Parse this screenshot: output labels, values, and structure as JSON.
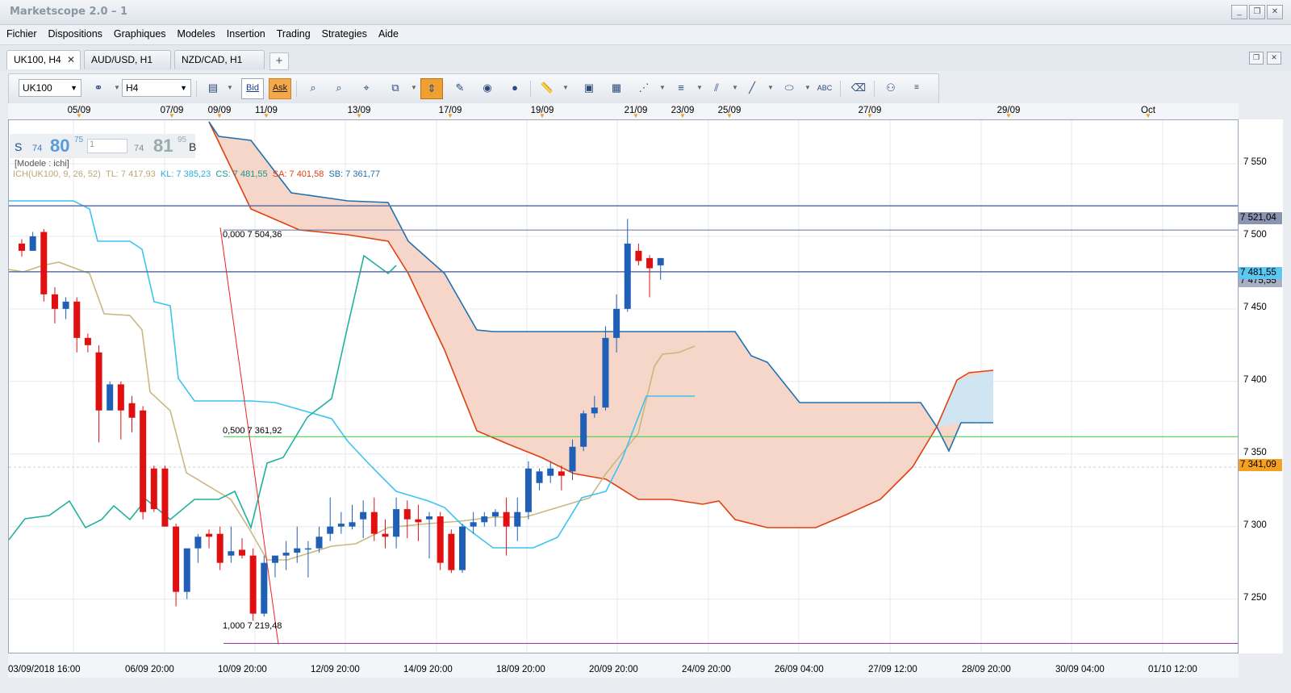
{
  "window": {
    "title": "Marketscope 2.0 – 1"
  },
  "menu": [
    "Fichier",
    "Dispositions",
    "Graphiques",
    "Modeles",
    "Insertion",
    "Trading",
    "Strategies",
    "Aide"
  ],
  "tabs": [
    {
      "label": "UK100, H4",
      "active": true
    },
    {
      "label": "AUD/USD, H1",
      "active": false
    },
    {
      "label": "NZD/CAD, H1",
      "active": false
    }
  ],
  "toolbar": {
    "instrument": "UK100",
    "timeframe": "H4",
    "bid_label": "Bid",
    "ask_label": "Ask"
  },
  "quote": {
    "sell_label": "S",
    "sell_small": "74",
    "sell_big": "80",
    "sell_sup": "75",
    "amount": "1",
    "buy_small": "74",
    "buy_big": "81",
    "buy_sup": "95",
    "buy_label": "B"
  },
  "indicator": {
    "model_label": "[Modele : ichi]",
    "ich": "ICH(UK100, 9, 26, 52)",
    "tl": "TL: 7 417,93",
    "kl": "KL: 7 385,23",
    "cs": "CS: 7 481,55",
    "sa": "SA: 7 401,58",
    "sb": "SB: 7 361,77"
  },
  "fib": {
    "level0": "0,000 7 504,36",
    "level50": "0,500 7 361,92",
    "level100": "1,000 7 219,48"
  },
  "price_boxes": {
    "upper": "7 521,04",
    "current": "7 481,55",
    "behind": "7 475,55",
    "orange": "7 341,09"
  },
  "colors": {
    "up": "#1f5fb5",
    "down": "#e01010",
    "cloud": "#f5d6c8",
    "tenkan": "#c8b880",
    "kijun": "#3cc4f0",
    "chikou": "#20b0a0",
    "spanA": "#e04010",
    "spanB": "#2070b0"
  },
  "chart_data": {
    "type": "candlestick",
    "instrument": "UK100",
    "timeframe": "H4",
    "y_ticks": [
      "7 550",
      "7 500",
      "7 450",
      "7 400",
      "7 350",
      "7 300",
      "7 250"
    ],
    "ylim": [
      7212,
      7580
    ],
    "top_dates": [
      "05/09",
      "07/09",
      "09/09",
      "11/09",
      "13/09",
      "17/09",
      "19/09",
      "21/09",
      "23/09",
      "25/09",
      "27/09",
      "29/09",
      "Oct"
    ],
    "bottom_dates": [
      "03/09/2018 16:00",
      "06/09 20:00",
      "10/09 20:00",
      "12/09 20:00",
      "14/09 20:00",
      "18/09 20:00",
      "20/09 20:00",
      "24/09 20:00",
      "26/09 04:00",
      "27/09 12:00",
      "28/09 20:00",
      "30/09 04:00",
      "01/10 12:00"
    ],
    "candles": [
      [
        7495,
        7498,
        7486,
        7490
      ],
      [
        7490,
        7503,
        7495,
        7500
      ],
      [
        7503,
        7505,
        7455,
        7460
      ],
      [
        7460,
        7465,
        7440,
        7450
      ],
      [
        7450,
        7458,
        7443,
        7455
      ],
      [
        7455,
        7458,
        7420,
        7430
      ],
      [
        7430,
        7433,
        7420,
        7425
      ],
      [
        7420,
        7425,
        7358,
        7380
      ],
      [
        7380,
        7400,
        7383,
        7398
      ],
      [
        7398,
        7400,
        7360,
        7380
      ],
      [
        7385,
        7390,
        7365,
        7375
      ],
      [
        7380,
        7383,
        7305,
        7310
      ],
      [
        7340,
        7342,
        7310,
        7312
      ],
      [
        7340,
        7342,
        7300,
        7300
      ],
      [
        7300,
        7302,
        7245,
        7255
      ],
      [
        7255,
        7275,
        7250,
        7285
      ],
      [
        7285,
        7295,
        7275,
        7293
      ],
      [
        7295,
        7298,
        7285,
        7293
      ],
      [
        7295,
        7300,
        7270,
        7275
      ],
      [
        7280,
        7300,
        7275,
        7283
      ],
      [
        7284,
        7292,
        7278,
        7280
      ],
      [
        7280,
        7285,
        7235,
        7240
      ],
      [
        7240,
        7280,
        7238,
        7275
      ],
      [
        7275,
        7280,
        7265,
        7280
      ],
      [
        7280,
        7290,
        7270,
        7282
      ],
      [
        7282,
        7300,
        7275,
        7285
      ],
      [
        7285,
        7290,
        7265,
        7285
      ],
      [
        7285,
        7300,
        7282,
        7293
      ],
      [
        7295,
        7320,
        7290,
        7300
      ],
      [
        7300,
        7310,
        7295,
        7302
      ],
      [
        7300,
        7315,
        7298,
        7303
      ],
      [
        7305,
        7318,
        7292,
        7310
      ],
      [
        7310,
        7320,
        7290,
        7295
      ],
      [
        7295,
        7305,
        7285,
        7293
      ],
      [
        7293,
        7320,
        7285,
        7312
      ],
      [
        7312,
        7318,
        7292,
        7305
      ],
      [
        7305,
        7315,
        7290,
        7303
      ],
      [
        7305,
        7310,
        7278,
        7307
      ],
      [
        7307,
        7310,
        7270,
        7275
      ],
      [
        7295,
        7298,
        7268,
        7270
      ],
      [
        7270,
        7302,
        7268,
        7300
      ],
      [
        7300,
        7310,
        7295,
        7303
      ],
      [
        7303,
        7310,
        7300,
        7307
      ],
      [
        7307,
        7312,
        7300,
        7310
      ],
      [
        7310,
        7320,
        7280,
        7300
      ],
      [
        7300,
        7320,
        7290,
        7310
      ],
      [
        7310,
        7345,
        7305,
        7340
      ],
      [
        7330,
        7340,
        7325,
        7338
      ],
      [
        7335,
        7345,
        7330,
        7340
      ],
      [
        7338,
        7342,
        7325,
        7335
      ],
      [
        7338,
        7360,
        7332,
        7355
      ],
      [
        7355,
        7380,
        7352,
        7378
      ],
      [
        7378,
        7390,
        7375,
        7382
      ],
      [
        7382,
        7438,
        7380,
        7430
      ],
      [
        7430,
        7460,
        7420,
        7450
      ],
      [
        7450,
        7512,
        7448,
        7495
      ],
      [
        7490,
        7495,
        7480,
        7483
      ],
      [
        7485,
        7487,
        7458,
        7478
      ],
      [
        7480,
        7485,
        7470,
        7485
      ]
    ]
  }
}
